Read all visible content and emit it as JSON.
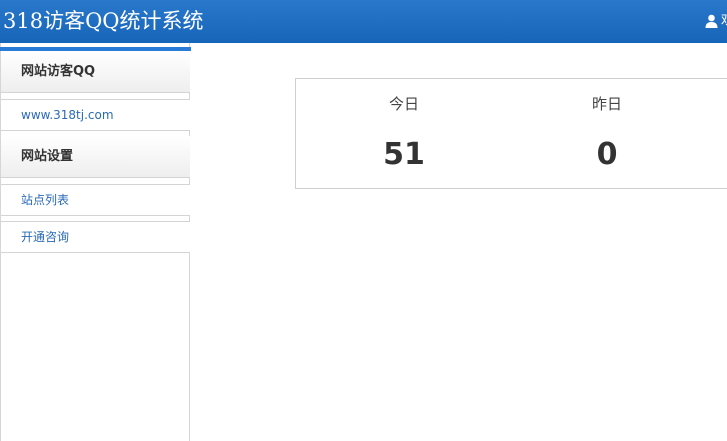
{
  "header": {
    "app_title": "318访客QQ统计系统",
    "user_greeting": "欢"
  },
  "sidebar": {
    "sections": [
      {
        "title": "网站访客QQ",
        "items": [
          "www.318tj.com"
        ]
      },
      {
        "title": "网站设置",
        "items": [
          "站点列表",
          "开通咨询"
        ]
      }
    ]
  },
  "stats": [
    {
      "label": "今日",
      "value": "51"
    },
    {
      "label": "昨日",
      "value": "0"
    }
  ],
  "colors": {
    "header_bg": "#1765b8",
    "accent": "#2a7ad8",
    "link": "#2a6ab8"
  }
}
